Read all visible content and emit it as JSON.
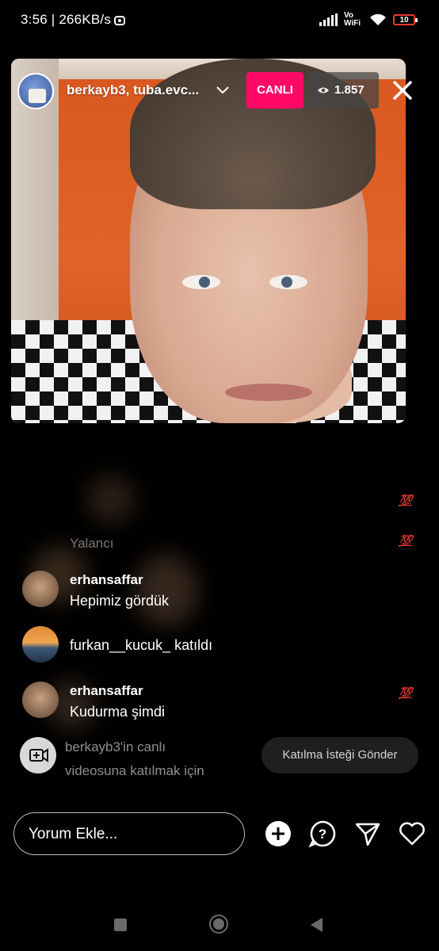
{
  "status_bar": {
    "time": "3:56 | 266KB/s",
    "network": "Vo WiFi",
    "battery": "10"
  },
  "live": {
    "host_names": "berkayb3, tuba.evc...",
    "live_label": "CANLI",
    "viewer_count": "1.857",
    "accent_color": "#ff0969"
  },
  "comments": [
    {
      "text": "Yalancı"
    },
    {
      "username": "erhansaffar",
      "text": "Hepimiz gördük"
    },
    {
      "username": "furkan__kucuk_",
      "text": "furkan__kucuk_ katıldı"
    },
    {
      "username": "erhansaffar",
      "text": "Kudurma şimdi"
    }
  ],
  "reactions": [
    "💯",
    "💯",
    "💯"
  ],
  "join_request": {
    "text_line1": "berkayb3'in canlı",
    "text_line2": "videosuna katılmak için",
    "button_label": "Katılma İsteği Gönder"
  },
  "composer": {
    "placeholder": "Yorum Ekle..."
  }
}
